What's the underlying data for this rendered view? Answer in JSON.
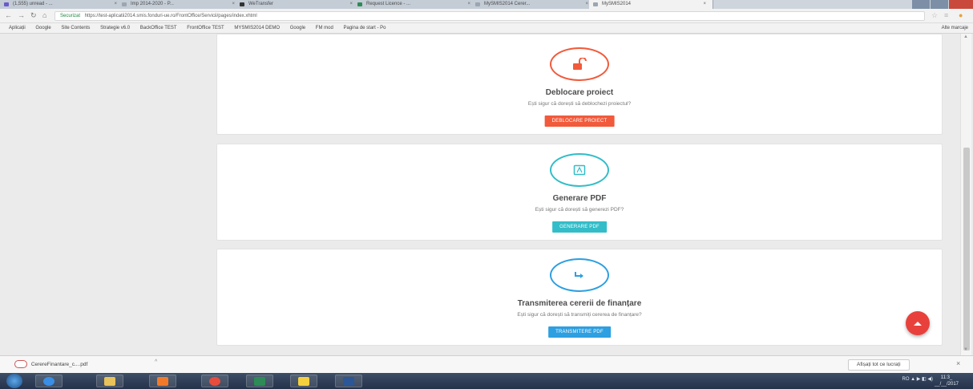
{
  "browser": {
    "tabs": [
      {
        "label": "(1,555) unread - ...",
        "close": "×",
        "color": "#6a5acd",
        "active": false
      },
      {
        "label": "Imp 2014-2020 - P...",
        "close": "×",
        "color": "#9aa6b2",
        "active": false
      },
      {
        "label": "WeTransfer",
        "close": "×",
        "color": "#333333",
        "active": false
      },
      {
        "label": "Request Licence - ...",
        "close": "×",
        "color": "#2e8b57",
        "active": false
      },
      {
        "label": "MySMIS2014 Cerer...",
        "close": "×",
        "color": "#9aa6b2",
        "active": false
      },
      {
        "label": "MySMIS2014",
        "close": "×",
        "color": "#9aa6b2",
        "active": true
      }
    ],
    "nav": {
      "back": "←",
      "forward": "→",
      "reload": "↻",
      "home": "⌂"
    },
    "address": {
      "secure_label": "Securizat",
      "url": "https://test-aplicatii2014.smis.fonduri-ue.ro/FrontOffice/Servicii/pages/index.xhtml"
    },
    "toolbar_icons": {
      "star": "☆",
      "menu": "≡"
    },
    "bookmarks": [
      "Aplicații",
      "Google",
      "Site Contents",
      "Strategie v6.0",
      "BackOffice TEST",
      "FrontOffice TEST",
      "MYSMIS2014 DEMO",
      "Google",
      "FM mod",
      "Pagina de start - Po"
    ],
    "bookmarks_more": "Alte marcaje"
  },
  "cards": [
    {
      "title": "Deblocare proiect",
      "text": "Ești sigur că dorești să deblochezi proiectul?",
      "button": "DEBLOCARE PROIECT",
      "accent": "#f15a3b",
      "icon": "unlock-icon"
    },
    {
      "title": "Generare PDF",
      "text": "Ești sigur că dorești să generezi PDF?",
      "button": "GENERARE PDF",
      "accent": "#33bdc8",
      "icon": "pdf-icon"
    },
    {
      "title": "Transmiterea cererii de finanțare",
      "text": "Ești sigur că dorești să transmiți cererea de finanțare?",
      "button": "TRANSMITERE PDF",
      "accent": "#2e9fe0",
      "icon": "share-arrow-icon"
    }
  ],
  "fab": {
    "icon": "chevron-up-icon",
    "color": "#e8413c"
  },
  "download_shelf": {
    "file_name": "CerereFinantare_c....pdf",
    "caret": "^",
    "show_all": "Afișați tot ce lucrați",
    "close": "×"
  },
  "taskbar": {
    "apps": [
      {
        "icon": "ie-icon",
        "color": "#3a8ee6"
      },
      {
        "icon": "folder-icon",
        "color": "#e8c25a"
      },
      {
        "icon": "media-player-icon",
        "color": "#f07a2a"
      },
      {
        "icon": "chrome-icon",
        "color": "#e74c3c"
      },
      {
        "icon": "excel-icon",
        "color": "#2e8b57"
      },
      {
        "icon": "notes-icon",
        "color": "#f4d03f"
      },
      {
        "icon": "word-icon",
        "color": "#2b5797"
      }
    ],
    "tray": "RO  ▲  ▶  ◧  ◀)",
    "time": "11:3_",
    "date": "__/__/2017"
  }
}
